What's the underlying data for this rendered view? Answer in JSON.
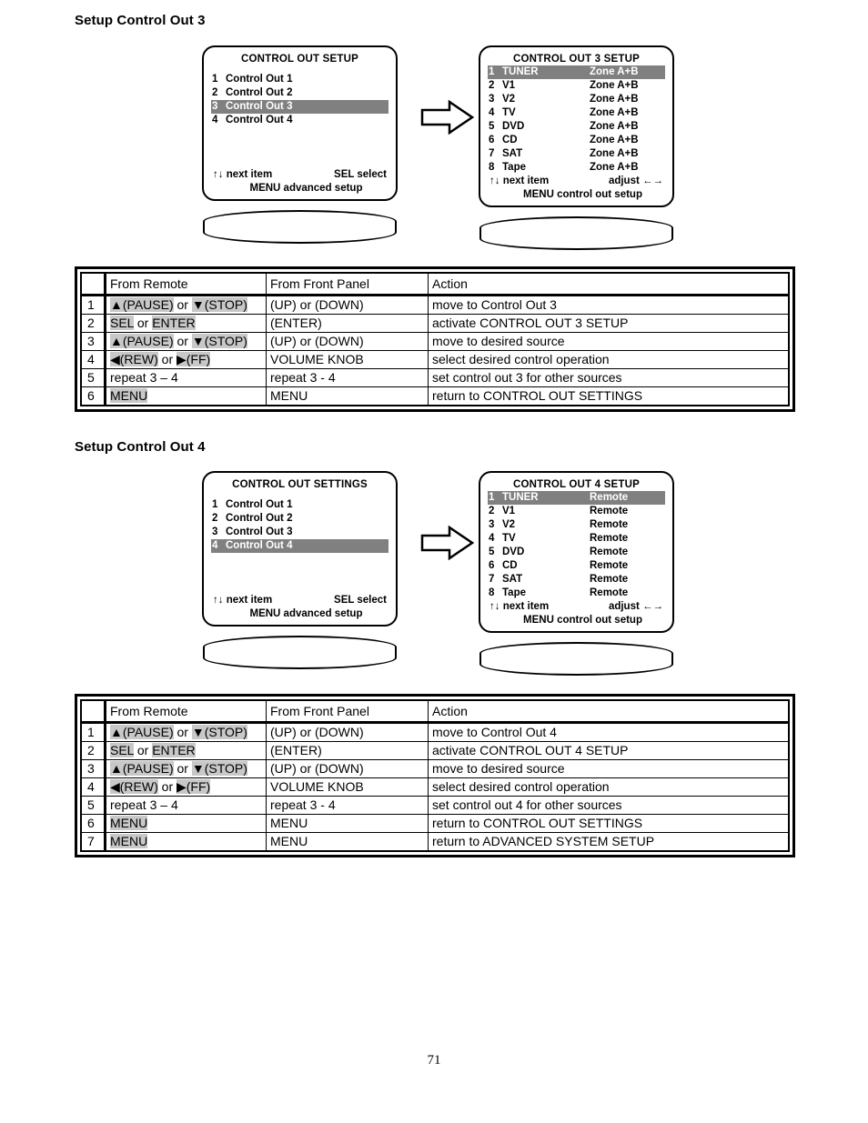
{
  "page": {
    "number": "71"
  },
  "sections": [
    {
      "title": "Setup Control Out 3",
      "screen_left": {
        "title": "CONTROL OUT SETUP",
        "rows": [
          {
            "num": "1",
            "name": "Control Out 1",
            "value": "",
            "highlight": false
          },
          {
            "num": "2",
            "name": "Control Out 2",
            "value": "",
            "highlight": false
          },
          {
            "num": "3",
            "name": "Control Out 3",
            "value": "",
            "highlight": true
          },
          {
            "num": "4",
            "name": "Control Out 4",
            "value": "",
            "highlight": false
          }
        ],
        "blank_rows": 3,
        "foot_left": "↑↓  next item",
        "foot_right": "SEL  select",
        "foot_bottom": "MENU advanced setup"
      },
      "screen_right": {
        "title": "CONTROL OUT 3 SETUP",
        "rows": [
          {
            "num": "1",
            "name": "TUNER",
            "value": "Zone A+B",
            "highlight": true
          },
          {
            "num": "2",
            "name": "V1",
            "value": "Zone A+B",
            "highlight": false
          },
          {
            "num": "3",
            "name": "V2",
            "value": "Zone A+B",
            "highlight": false
          },
          {
            "num": "4",
            "name": "TV",
            "value": "Zone A+B",
            "highlight": false
          },
          {
            "num": "5",
            "name": "DVD",
            "value": "Zone A+B",
            "highlight": false
          },
          {
            "num": "6",
            "name": "CD",
            "value": "Zone A+B",
            "highlight": false
          },
          {
            "num": "7",
            "name": "SAT",
            "value": "Zone A+B",
            "highlight": false
          },
          {
            "num": "8",
            "name": "Tape",
            "value": "Zone A+B",
            "highlight": false
          }
        ],
        "blank_rows": 0,
        "foot_left": "↑↓  next item",
        "foot_right": "adjust  ←→",
        "foot_bottom": "MENU  control out setup"
      },
      "table": {
        "headers": {
          "num": "",
          "remote": "From Remote",
          "front": "From Front Panel",
          "action": "Action"
        },
        "rows": [
          {
            "num": "1",
            "remote_parts": [
              {
                "text": "▲(PAUSE)",
                "key": true
              },
              {
                "text": " or ",
                "key": false
              },
              {
                "text": "▼(STOP)",
                "key": true
              }
            ],
            "front": "(UP) or (DOWN)",
            "action": "move to Control Out 3"
          },
          {
            "num": "2",
            "remote_parts": [
              {
                "text": "SEL",
                "key": true
              },
              {
                "text": " or ",
                "key": false
              },
              {
                "text": "ENTER",
                "key": true
              }
            ],
            "front": "(ENTER)",
            "action": "activate CONTROL OUT 3 SETUP"
          },
          {
            "num": "3",
            "remote_parts": [
              {
                "text": "▲(PAUSE)",
                "key": true
              },
              {
                "text": " or ",
                "key": false
              },
              {
                "text": "▼(STOP)",
                "key": true
              }
            ],
            "front": "(UP) or (DOWN)",
            "action": "move to desired source"
          },
          {
            "num": "4",
            "remote_parts": [
              {
                "text": "◀(REW)",
                "key": true
              },
              {
                "text": " or ",
                "key": false
              },
              {
                "text": "▶(FF)",
                "key": true
              }
            ],
            "front": "VOLUME KNOB",
            "action": "select desired control operation"
          },
          {
            "num": "5",
            "remote_parts": [
              {
                "text": "repeat 3 – 4",
                "key": false
              }
            ],
            "front": "repeat 3 - 4",
            "action": "set control out 3 for other sources"
          },
          {
            "num": "6",
            "remote_parts": [
              {
                "text": "MENU",
                "key": true
              }
            ],
            "front": "MENU",
            "action": "return to CONTROL OUT SETTINGS"
          }
        ]
      }
    },
    {
      "title": "Setup Control Out 4",
      "screen_left": {
        "title": "CONTROL OUT SETTINGS",
        "rows": [
          {
            "num": "1",
            "name": "Control Out 1",
            "value": "",
            "highlight": false
          },
          {
            "num": "2",
            "name": "Control Out 2",
            "value": "",
            "highlight": false
          },
          {
            "num": "3",
            "name": "Control Out 3",
            "value": "",
            "highlight": false
          },
          {
            "num": "4",
            "name": "Control Out 4",
            "value": "",
            "highlight": true
          }
        ],
        "blank_rows": 3,
        "foot_left": "↑↓  next item",
        "foot_right": "SEL  select",
        "foot_bottom": "MENU advanced setup"
      },
      "screen_right": {
        "title": "CONTROL OUT 4 SETUP",
        "rows": [
          {
            "num": "1",
            "name": "TUNER",
            "value": "Remote",
            "highlight": true
          },
          {
            "num": "2",
            "name": "V1",
            "value": "Remote",
            "highlight": false
          },
          {
            "num": "3",
            "name": "V2",
            "value": "Remote",
            "highlight": false
          },
          {
            "num": "4",
            "name": "TV",
            "value": "Remote",
            "highlight": false
          },
          {
            "num": "5",
            "name": "DVD",
            "value": "Remote",
            "highlight": false
          },
          {
            "num": "6",
            "name": "CD",
            "value": "Remote",
            "highlight": false
          },
          {
            "num": "7",
            "name": "SAT",
            "value": "Remote",
            "highlight": false
          },
          {
            "num": "8",
            "name": "Tape",
            "value": "Remote",
            "highlight": false
          }
        ],
        "blank_rows": 0,
        "foot_left": "↑↓  next item",
        "foot_right": "adjust  ←→",
        "foot_bottom": "MENU  control out setup"
      },
      "table": {
        "headers": {
          "num": "",
          "remote": "From Remote",
          "front": "From Front Panel",
          "action": "Action"
        },
        "rows": [
          {
            "num": "1",
            "remote_parts": [
              {
                "text": "▲(PAUSE)",
                "key": true
              },
              {
                "text": " or ",
                "key": false
              },
              {
                "text": "▼(STOP)",
                "key": true
              }
            ],
            "front": "(UP) or (DOWN)",
            "action": "move to Control Out 4"
          },
          {
            "num": "2",
            "remote_parts": [
              {
                "text": "SEL",
                "key": true
              },
              {
                "text": " or ",
                "key": false
              },
              {
                "text": "ENTER",
                "key": true
              }
            ],
            "front": "(ENTER)",
            "action": "activate CONTROL OUT 4 SETUP"
          },
          {
            "num": "3",
            "remote_parts": [
              {
                "text": "▲(PAUSE)",
                "key": true
              },
              {
                "text": " or ",
                "key": false
              },
              {
                "text": "▼(STOP)",
                "key": true
              }
            ],
            "front": "(UP) or (DOWN)",
            "action": "move to desired source"
          },
          {
            "num": "4",
            "remote_parts": [
              {
                "text": "◀(REW)",
                "key": true
              },
              {
                "text": " or ",
                "key": false
              },
              {
                "text": "▶(FF)",
                "key": true
              }
            ],
            "front": "VOLUME KNOB",
            "action": "select desired control operation"
          },
          {
            "num": "5",
            "remote_parts": [
              {
                "text": "repeat 3 – 4",
                "key": false
              }
            ],
            "front": "repeat 3 - 4",
            "action": "set control out 4 for other sources"
          },
          {
            "num": "6",
            "remote_parts": [
              {
                "text": "MENU",
                "key": true
              }
            ],
            "front": "MENU",
            "action": "return to CONTROL OUT SETTINGS"
          },
          {
            "num": "7",
            "remote_parts": [
              {
                "text": "MENU",
                "key": true
              }
            ],
            "front": "MENU",
            "action": "return to ADVANCED SYSTEM SETUP"
          }
        ]
      }
    }
  ],
  "colors": {
    "highlight_bar": "#808080",
    "key_highlight": "#c8c8c8",
    "ink": "#000000",
    "paper": "#ffffff"
  }
}
